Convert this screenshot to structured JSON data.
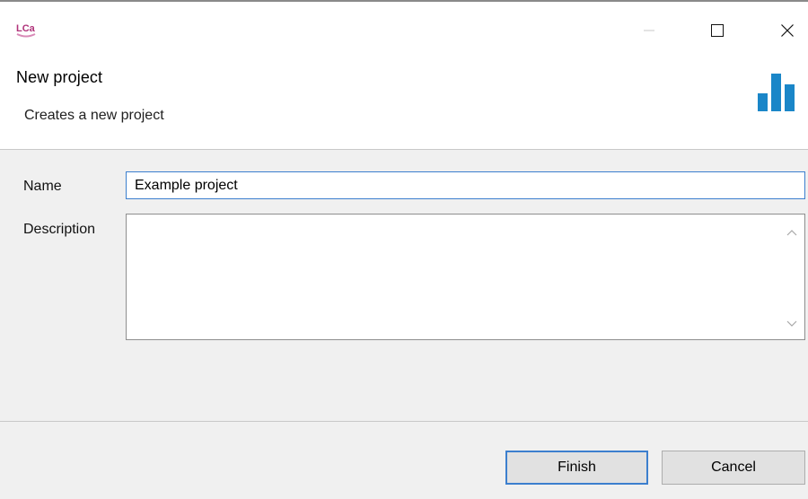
{
  "window": {
    "app_icon": "lca-app-icon",
    "controls": {
      "minimize_icon": "minimize-icon",
      "maximize_icon": "maximize-icon",
      "close_icon": "close-icon"
    }
  },
  "header": {
    "title": "New project",
    "subtitle": "Creates a new project",
    "brand_icon": "bar-chart-icon",
    "brand_color": "#1a86c8"
  },
  "form": {
    "name_label": "Name",
    "name_value": "Example project",
    "description_label": "Description",
    "description_value": ""
  },
  "footer": {
    "finish_label": "Finish",
    "cancel_label": "Cancel"
  },
  "colors": {
    "focus_border": "#3c7fce",
    "panel_bg": "#f0f0f0",
    "app_icon_color": "#b0337a"
  }
}
